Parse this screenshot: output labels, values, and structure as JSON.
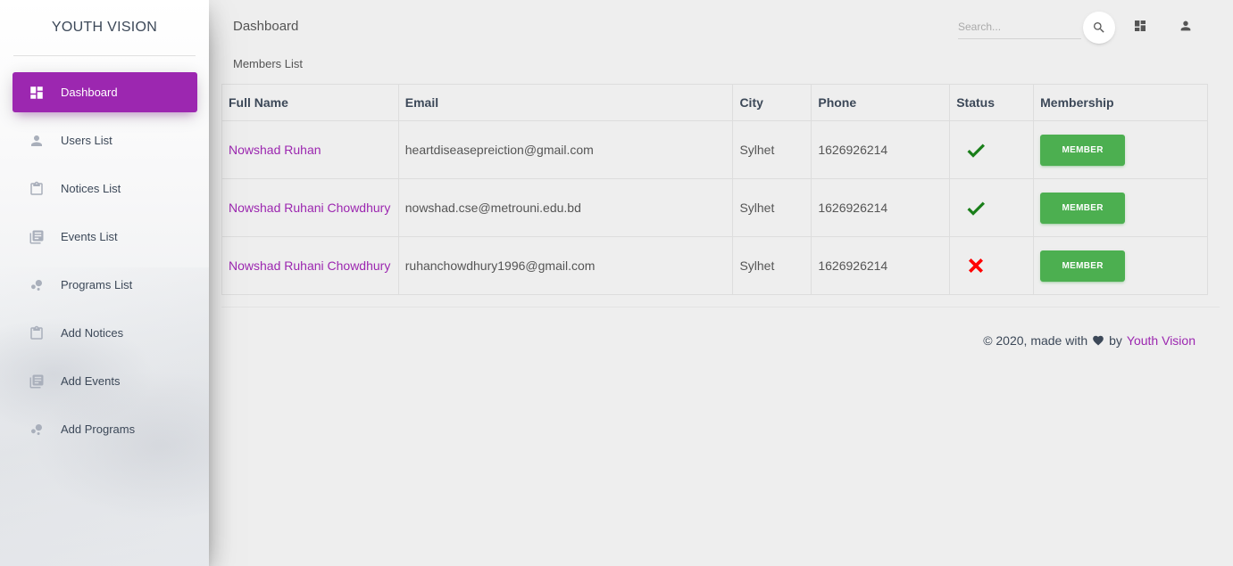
{
  "brand": {
    "title": "YOUTH VISION"
  },
  "sidebar": {
    "items": [
      {
        "label": "Dashboard",
        "icon": "dashboard-icon",
        "active": true
      },
      {
        "label": "Users List",
        "icon": "person-icon"
      },
      {
        "label": "Notices List",
        "icon": "clipboard-icon"
      },
      {
        "label": "Events List",
        "icon": "library-books-icon"
      },
      {
        "label": "Programs List",
        "icon": "bubble-chart-icon"
      },
      {
        "label": "Add Notices",
        "icon": "clipboard-icon"
      },
      {
        "label": "Add Events",
        "icon": "library-books-icon"
      },
      {
        "label": "Add Programs",
        "icon": "bubble-chart-icon"
      }
    ]
  },
  "header": {
    "title": "Dashboard",
    "search": {
      "placeholder": "Search...",
      "value": ""
    }
  },
  "main": {
    "section_title": "Members List",
    "table": {
      "columns": [
        "Full Name",
        "Email",
        "City",
        "Phone",
        "Status",
        "Membership"
      ],
      "rows": [
        {
          "name": "Nowshad Ruhan",
          "email": "heartdiseasepreiction@gmail.com",
          "city": "Sylhet",
          "phone": "1626926214",
          "status": "check-icon",
          "membership": "MEMBER"
        },
        {
          "name": "Nowshad Ruhani Chowdhury",
          "email": "nowshad.cse@metrouni.edu.bd",
          "city": "Sylhet",
          "phone": "1626926214",
          "status": "check-icon",
          "membership": "MEMBER"
        },
        {
          "name": "Nowshad Ruhani Chowdhury",
          "email": "ruhanchowdhury1996@gmail.com",
          "city": "Sylhet",
          "phone": "1626926214",
          "status": "cross-icon",
          "membership": "MEMBER"
        }
      ]
    }
  },
  "footer": {
    "prefix": "© 2020, made with",
    "by": "by",
    "link": "Youth Vision"
  },
  "colors": {
    "primary": "#9c27b0",
    "success": "#4caf50",
    "check": "#1a7f1a",
    "cross": "#ff0000",
    "background": "#eeeeee"
  }
}
